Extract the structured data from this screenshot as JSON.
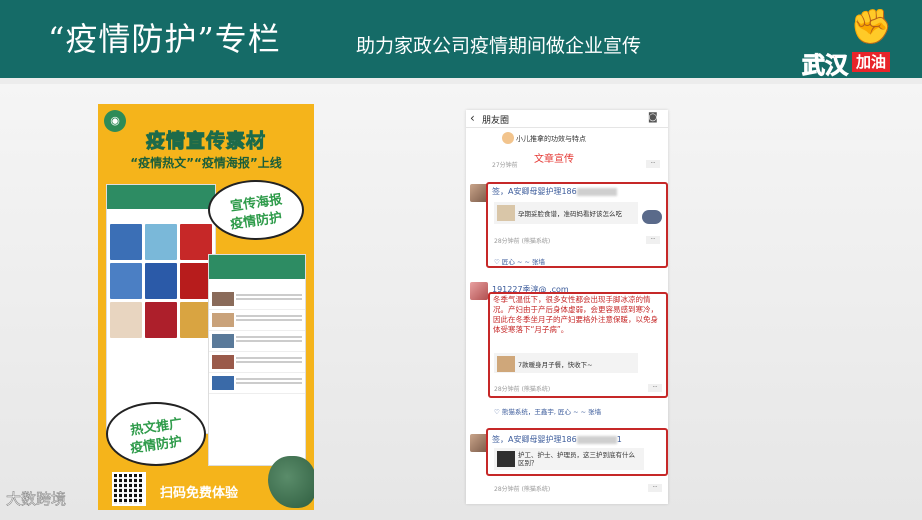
{
  "header": {
    "title": "“疫情防护”专栏",
    "subtitle": "助力家政公司疫情期间做企业宣传",
    "badge_main": "武汉",
    "badge_accent": "加油"
  },
  "poster": {
    "title": "疫情宣传素材",
    "subtitle": "“疫情热文”“疫情海报”上线",
    "bubble_top_line1": "宣传海报",
    "bubble_top_line2": "疫情防护",
    "bubble_bottom_line1": "热文推广",
    "bubble_bottom_line2": "疫情防护",
    "scan_text": "扫码免费体验"
  },
  "feed": {
    "title": "朋友圈",
    "post1_text": "小儿推拿的功效与特点",
    "post1_time": "27分钟前",
    "label": "文章宣传",
    "post2": {
      "name": "签，A安卿母婴护理186",
      "link": "孕期妥脸食谱，准码妈看好该怎么吃",
      "time": "28分钟前",
      "source": "(熊猫系统)",
      "likes": "♡ 匠心 ~ ~ 张墙"
    },
    "post3": {
      "name": "191227季淳@ .com",
      "body": "冬季气温低下，很多女性都会出现手脚冰凉的情况。产妇由于产后身体虚弱，会更容易感到寒冷，因此在冬季坐月子的产妇要格外注意保暖，以免身体受寒落下“月子病”。",
      "link": "7款暖身月子餐，快收下~",
      "time": "28分钟前",
      "source": "(熊猫系统)",
      "likes": "♡ 熊猫系统，王鑫宇, 匠心 ~ ~ 张墙"
    },
    "post4": {
      "name": "签，A安卿母婴护理186",
      "name_tail": "1",
      "link": "护工、护士、护理员，这三护到底有什么区别？",
      "time": "28分钟前",
      "source": "(熊猫系统)"
    }
  },
  "watermark": "大数跨境",
  "colors": {
    "header_bg": "#156b67",
    "poster_bg": "#f5b41b",
    "accent_red": "#c62828"
  }
}
